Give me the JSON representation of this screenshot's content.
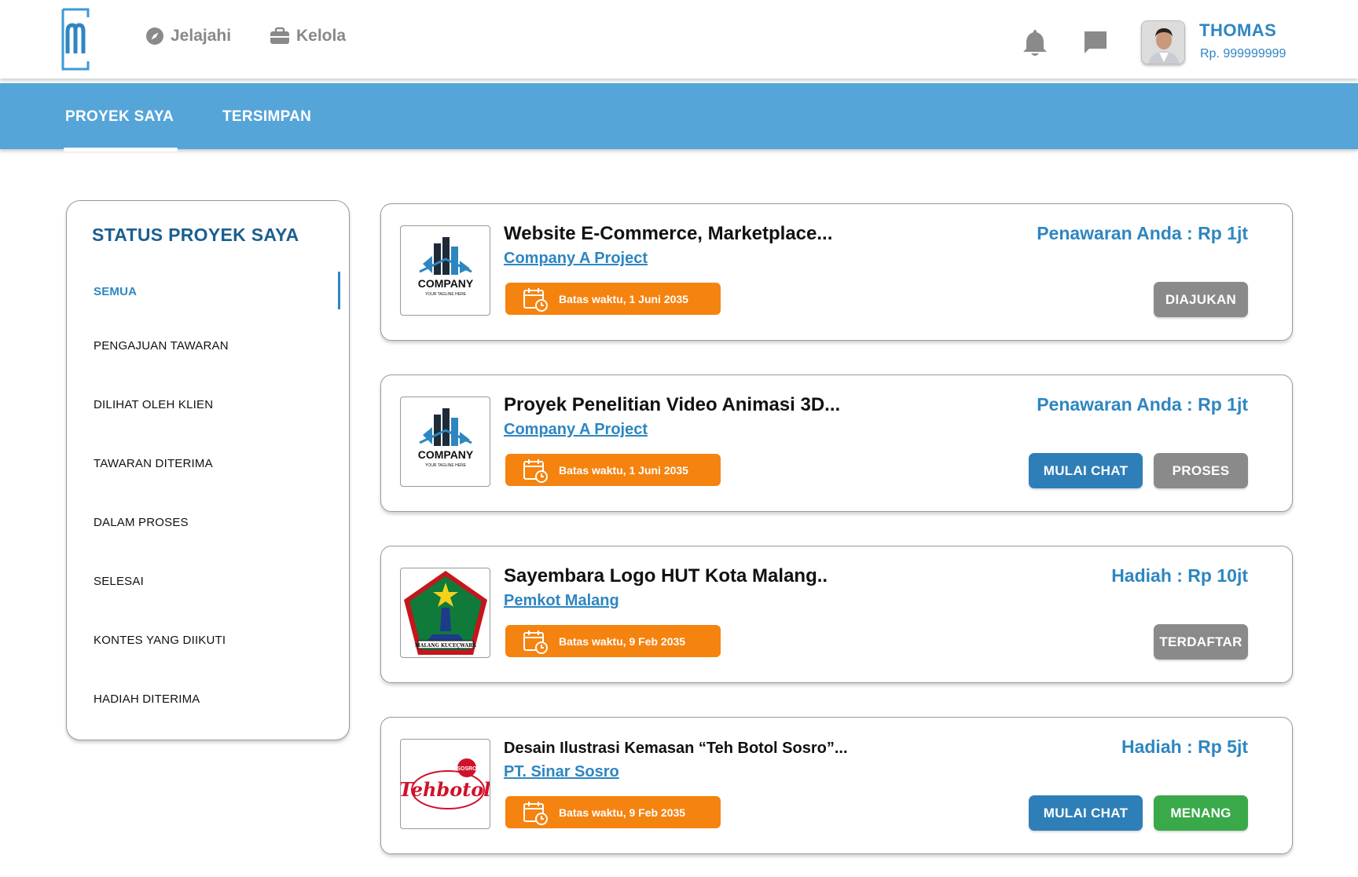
{
  "header": {
    "nav": [
      {
        "label": "Jelajahi",
        "icon": "compass-icon"
      },
      {
        "label": "Kelola",
        "icon": "briefcase-icon"
      }
    ],
    "user": {
      "name": "THOMAS",
      "balance": "Rp. 999999999"
    }
  },
  "tabs": [
    {
      "label": "PROYEK SAYA",
      "active": true
    },
    {
      "label": "TERSIMPAN",
      "active": false
    }
  ],
  "sidebar": {
    "title": "STATUS PROYEK SAYA",
    "filters": [
      "SEMUA",
      "PENGAJUAN TAWARAN",
      "DILIHAT OLEH KLIEN",
      "TAWARAN DITERIMA",
      "DALAM PROSES",
      "SELESAI",
      "KONTES YANG DIIKUTI",
      "HADIAH DITERIMA"
    ],
    "active_filter": "SEMUA"
  },
  "cards": [
    {
      "title": "Website E-Commerce, Marketplace...",
      "client": "Company A Project",
      "deadline": "Batas waktu, 1 Juni 2035",
      "price": "Penawaran Anda : Rp 1jt",
      "status": "DIAJUKAN",
      "thumb": "company-logo",
      "thumb_text": "COMPANY",
      "thumb_tagline": "YOUR TAGLINE HERE"
    },
    {
      "title": "Proyek Penelitian Video Animasi 3D...",
      "client": "Company A Project",
      "deadline": "Batas waktu, 1 Juni 2035",
      "price": "Penawaran Anda : Rp 1jt",
      "chat": "MULAI CHAT",
      "status": "PROSES",
      "thumb": "company-logo",
      "thumb_text": "COMPANY",
      "thumb_tagline": "YOUR TAGLINE HERE"
    },
    {
      "title": "Sayembara Logo HUT Kota Malang..",
      "client": "Pemkot Malang",
      "deadline": "Batas waktu, 9 Feb 2035",
      "price": "Hadiah : Rp 10jt",
      "status": "TERDAFTAR",
      "thumb": "malang-emblem",
      "thumb_text": "MALANG KUCEÇWARA"
    },
    {
      "title": "Desain Ilustrasi Kemasan “Teh Botol Sosro”...",
      "client": "PT. Sinar Sosro",
      "deadline": "Batas waktu, 9 Feb 2035",
      "price": "Hadiah : Rp 5jt",
      "chat": "MULAI CHAT",
      "status": "MENANG",
      "thumb": "tehbotol-logo",
      "thumb_text": "Tehbotol",
      "thumb_badge": "SOSRO"
    }
  ],
  "colors": {
    "accent": "#2e86c1",
    "tabbar": "#55a5d8",
    "deadline": "#f5830f",
    "status_grey": "#8a8a8a",
    "chat_blue": "#2e7fb8",
    "win_green": "#3aa94a"
  }
}
